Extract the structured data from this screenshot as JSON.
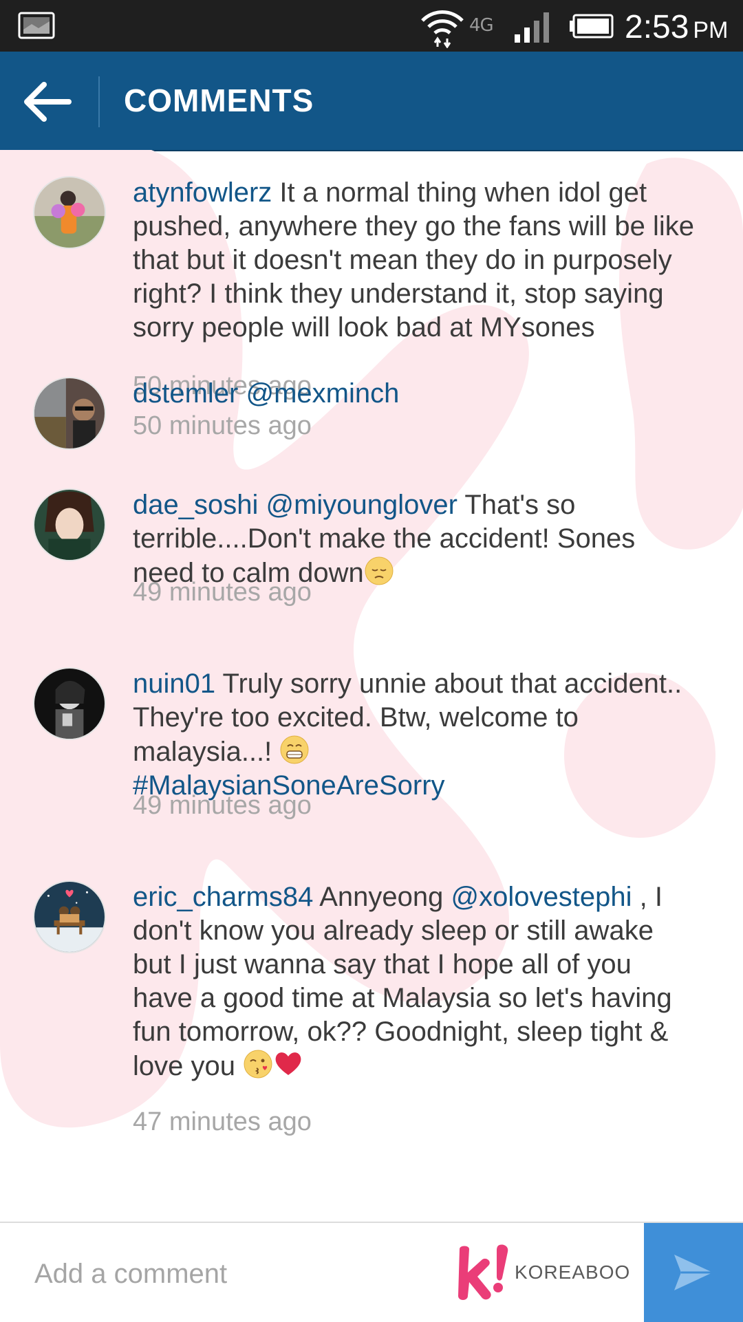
{
  "status_bar": {
    "network": "4G",
    "time": "2:53",
    "ampm": "PM"
  },
  "header": {
    "title": "COMMENTS"
  },
  "comments": [
    {
      "username": "atynfowlerz",
      "body": " It a normal thing when idol get pushed, anywhere they go the fans will be like that but it doesn't mean they do in purposely right? I think they understand it, stop saying sorry people will look bad at MYsones",
      "time": "50 minutes ago"
    },
    {
      "username": "dstemler",
      "mention": " @mexminch",
      "time": "50 minutes ago"
    },
    {
      "username": "dae_soshi",
      "mention": " @miyounglover",
      "body": " That's so terrible....Don't make the accident! Sones need to calm down",
      "emoji": "pensive-face-emoji",
      "time": "49 minutes ago"
    },
    {
      "username": "nuin01",
      "body": " Truly sorry unnie about that accident.. They're too excited. Btw, welcome to malaysia...! ",
      "emoji": "grinning-face-emoji",
      "hashtag": "#MalaysianSoneAreSorry",
      "time": "49 minutes ago"
    },
    {
      "username": "eric_charms84",
      "body_start": " Annyeong ",
      "mention": "@xolovestephi",
      "body_end": " , I don't know you already sleep or still awake but I just wanna say that I hope all of you have a good time at Malaysia so let's having fun tomorrow, ok?? Goodnight, sleep tight & love you ",
      "emoji": [
        "kiss-face-emoji",
        "red-heart-emoji"
      ],
      "time": "47 minutes ago"
    }
  ],
  "footer": {
    "placeholder": "Add a comment",
    "brand": "KOREABOO"
  },
  "colors": {
    "status_bar": "#1f1f1f",
    "header": "#125688",
    "link": "#125688",
    "send_button": "#3f8fd8",
    "watermark": "#fde8ec",
    "brand_pink": "#ea3d78"
  }
}
